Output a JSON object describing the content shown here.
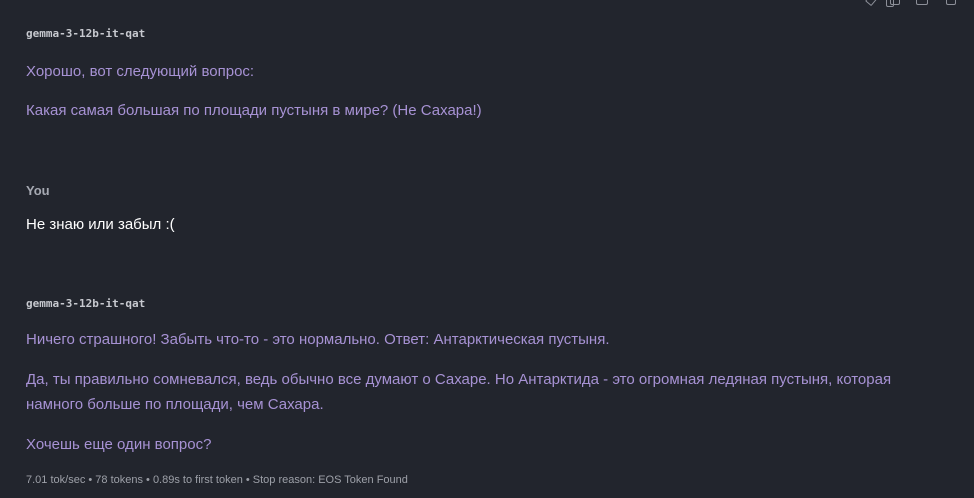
{
  "toolbar": {
    "icons": [
      "edit-icon",
      "copy-icon",
      "save-icon",
      "trash-icon"
    ]
  },
  "messages": [
    {
      "sender": "gemma-3-12b-it-qat",
      "paragraphs": [
        "Хорошо, вот следующий вопрос:",
        "Какая самая большая по площади пустыня в мире? (Не Сахара!)"
      ]
    },
    {
      "sender": "You",
      "paragraphs": [
        "Не знаю или забыл :("
      ]
    },
    {
      "sender": "gemma-3-12b-it-qat",
      "paragraphs": [
        "Ничего страшного! Забыть что-то - это нормально. Ответ: Антарктическая пустыня.",
        "Да, ты правильно сомневался, ведь обычно все думают о Сахаре. Но Антарктида - это огромная ледяная пустыня, которая намного больше по площади, чем Сахара.",
        "Хочешь еще один вопрос?"
      ],
      "stats": "7.01 tok/sec • 78 tokens • 0.89s to first token • Stop reason: EOS Token Found"
    }
  ],
  "colors": {
    "background": "#22252d",
    "assistant_text": "#a792d4",
    "user_text": "#ffffff",
    "meta_text": "#9da0a8"
  }
}
